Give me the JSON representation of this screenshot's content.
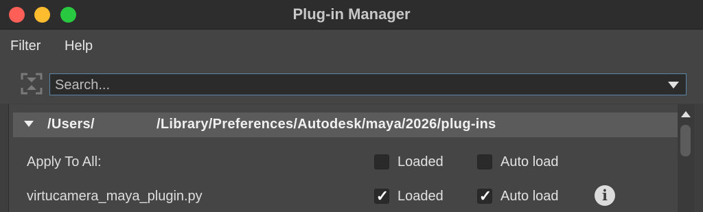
{
  "window": {
    "title": "Plug-in Manager"
  },
  "menubar": {
    "items": [
      {
        "label": "Filter"
      },
      {
        "label": "Help"
      }
    ]
  },
  "search": {
    "placeholder": "Search...",
    "value": ""
  },
  "path_section": {
    "path_part_1": "/Users/",
    "path_part_2": "/Library/Preferences/Autodesk/maya/2026/plug-ins",
    "expanded": true
  },
  "rows": [
    {
      "label": "Apply To All:",
      "loaded_label": "Loaded",
      "loaded_checked": false,
      "autoload_label": "Auto load",
      "autoload_checked": false
    },
    {
      "label": "virtucamera_maya_plugin.py",
      "loaded_label": "Loaded",
      "loaded_checked": true,
      "autoload_label": "Auto load",
      "autoload_checked": true,
      "info_icon": "info-icon"
    }
  ],
  "colors": {
    "close": "#ff5f57",
    "minimize": "#febc2e",
    "maximize": "#28c840",
    "focus_border": "#5a87a8"
  },
  "checkmark_glyph": "✓",
  "info_glyph": "i"
}
